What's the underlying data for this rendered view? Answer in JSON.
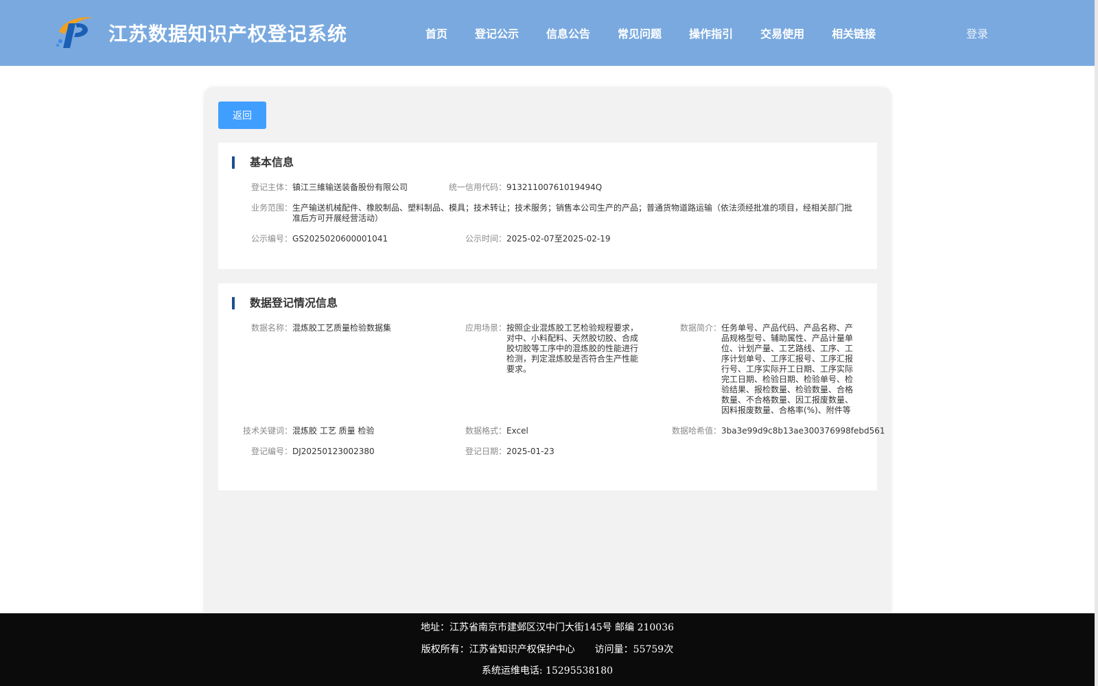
{
  "header": {
    "site_title": "江苏数据知识产权登记系统",
    "logo_icon": "ip-logo-icon",
    "nav": [
      "首页",
      "登记公示",
      "信息公告",
      "常见问题",
      "操作指引",
      "交易使用",
      "相关链接"
    ],
    "login_label": "登录"
  },
  "actions": {
    "back_label": "返回"
  },
  "basic_info": {
    "title": "基本信息",
    "subject_label": "登记主体：",
    "subject_value": "镇江三維输送装备股份有限公司",
    "credit_code_label": "统一信用代码：",
    "credit_code_value": "91321100761019494Q",
    "scope_label": "业务范围：",
    "scope_value": "生产输送机械配件、橡胶制品、塑料制品、模具；技术转让；技术服务；销售本公司生产的产品；普通货物道路运输（依法须经批准的项目，经相关部门批准后方可开展经营活动）",
    "notice_no_label": "公示编号：",
    "notice_no_value": "GS2025020600001041",
    "notice_time_label": "公示时间：",
    "notice_time_value": "2025-02-07至2025-02-19"
  },
  "data_info": {
    "title": "数据登记情况信息",
    "name_label": "数据名称：",
    "name_value": "混炼胶工艺质量检验数据集",
    "scene_label": "应用场景：",
    "scene_value": "按照企业混炼胶工艺检验规程要求，对中、小料配料、天然胶切胶、合成胶切胶等工序中的混炼胶的性能进行检测，判定混炼胶是否符合生产性能要求。",
    "intro_label": "数据简介：",
    "intro_value": "任务单号、产品代码、产品名称、产品规格型号、辅助属性、产品计量单位、计划产量、工艺路线、工序、工序计划单号、工序汇报号、工序汇报行号、工序实际开工日期、工序实际完工日期、检验日期、检验单号、检验结果、报检数量、检验数量、合格数量、不合格数量、因工报废数量、因料报废数量、合格率(%)、附件等",
    "keywords_label": "技术关键词：",
    "keywords_value": "混炼胶 工艺 质量 检验",
    "format_label": "数据格式：",
    "format_value": "Excel",
    "hash_label": "数据哈希值：",
    "hash_value": "3ba3e99d9c8b13ae300376998febd561",
    "reg_no_label": "登记编号：",
    "reg_no_value": "DJ20250123002380",
    "reg_date_label": "登记日期：",
    "reg_date_value": "2025-01-23"
  },
  "footer": {
    "address": "地址：江苏省南京市建邺区汉中门大街145号 邮编 210036",
    "copyright": "版权所有：江苏省知识产权保护中心",
    "visits": "访问量：55759次",
    "hotline": "系统运维电话: 15295538180"
  },
  "colors": {
    "header_bg": "#79a9df",
    "button_bg": "#409eff",
    "accent_bar": "#1d4f91",
    "footer_bg": "#0b0b0b"
  }
}
